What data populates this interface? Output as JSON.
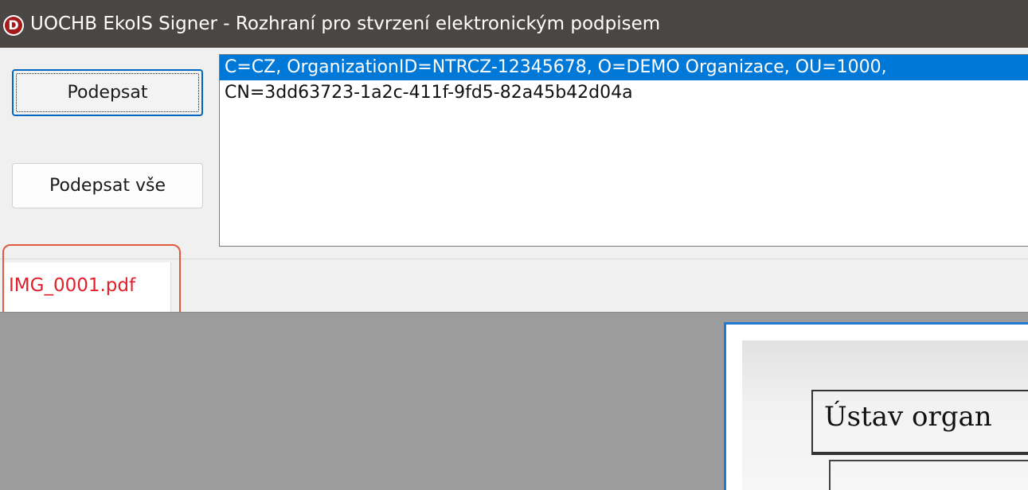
{
  "window": {
    "title": "UOCHB EkoIS Signer - Rozhraní pro stvrzení elektronickým podpisem",
    "icon_letter": "D",
    "icon": "app-logo-icon"
  },
  "actions": {
    "sign_label": "Podepsat",
    "sign_all_label": "Podepsat vše"
  },
  "certificates": {
    "lines": [
      "C=CZ, OrganizationID=NTRCZ-12345678, O=DEMO Organizace, OU=1000,",
      "CN=3dd63723-1a2c-411f-9fd5-82a45b42d04a"
    ]
  },
  "tabs": [
    {
      "label": "IMG_0001.pdf",
      "color": "#e0202a"
    }
  ],
  "document": {
    "visible_heading": "Ústav organ"
  },
  "colors": {
    "titlebar": "#4a4644",
    "selection": "#0078d7",
    "annotation": "#e05a40",
    "page_border": "#1f78d1",
    "viewer_bg": "#9c9c9c"
  }
}
